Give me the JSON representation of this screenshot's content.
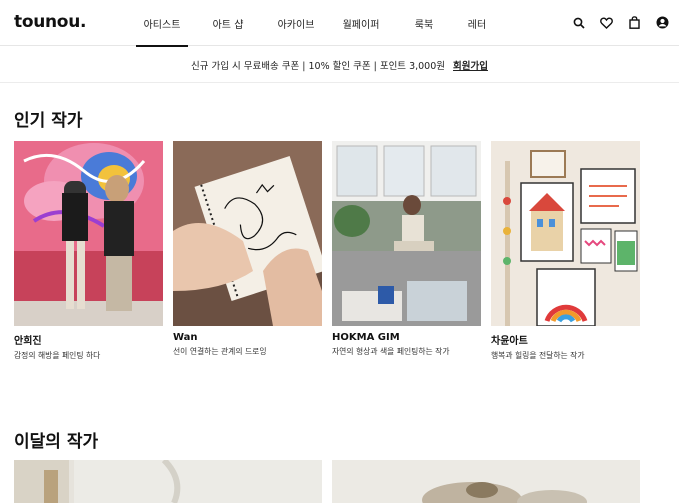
{
  "header": {
    "logo": "tounou.",
    "nav": [
      {
        "label": "아티스트",
        "active": true
      },
      {
        "label": "아트 샵",
        "active": false
      },
      {
        "label": "아카이브",
        "active": false
      },
      {
        "label": "월페이퍼",
        "active": false
      },
      {
        "label": "룩북",
        "active": false
      },
      {
        "label": "레터",
        "active": false
      }
    ],
    "icons": [
      "search-icon",
      "heart-icon",
      "shopping-bag-icon",
      "account-icon"
    ]
  },
  "promo": {
    "text": "신규 가입 시 무료배송 쿠폰 | 10% 할인 쿠폰 | 포인트 3,000원",
    "link": "회원가입"
  },
  "popular": {
    "title": "인기 작가",
    "artists": [
      {
        "name": "안희진",
        "desc": "감정의 해방을 페인팅 하다"
      },
      {
        "name": "Wan",
        "desc": "선이 연결하는 관계의 드로잉"
      },
      {
        "name": "HOKMA GIM",
        "desc": "자연의 형상과 색을 페인팅하는 작가"
      },
      {
        "name": "차윤아트",
        "desc": "행복과 힐링을 전달하는 작가"
      }
    ]
  },
  "monthly": {
    "title": "이달의 작가"
  },
  "colors": {
    "accent": "#111111",
    "border": "#e6e6e6"
  }
}
